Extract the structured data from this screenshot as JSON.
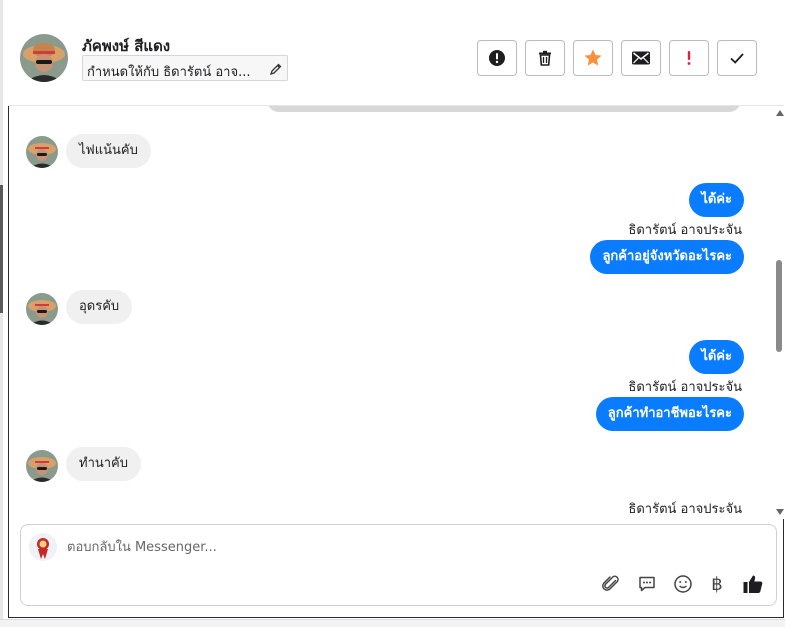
{
  "header": {
    "contact_name": "ภัคพงษ์ สีแดง",
    "assigned_to": "กำหนดให้กับ ธิดารัตน์ อาจ...",
    "actions": [
      {
        "icon": "alert-circle-icon",
        "name": "mark-spam-button"
      },
      {
        "icon": "trash-icon",
        "name": "delete-button"
      },
      {
        "icon": "star-icon",
        "name": "star-button"
      },
      {
        "icon": "envelope-icon",
        "name": "mark-unread-button"
      },
      {
        "icon": "exclamation-icon",
        "name": "follow-up-button"
      },
      {
        "icon": "check-icon",
        "name": "mark-done-button"
      }
    ]
  },
  "messages": [
    {
      "direction": "in",
      "text": "ไฟแน้นคับ"
    },
    {
      "direction": "out",
      "text": "ได้ค่ะ"
    },
    {
      "direction": "sender",
      "text": "ธิดารัตน์ อาจประจัน"
    },
    {
      "direction": "out",
      "text": "ลูกค้าอยู่จังหวัดอะไรคะ"
    },
    {
      "direction": "in",
      "text": "อุดรคับ"
    },
    {
      "direction": "out",
      "text": "ได้ค่ะ"
    },
    {
      "direction": "sender",
      "text": "ธิดารัตน์ อาจประจัน"
    },
    {
      "direction": "out",
      "text": "ลูกค้าทำอาชีพอะไรคะ"
    },
    {
      "direction": "in",
      "text": "ทำนาคับ"
    },
    {
      "direction": "sender",
      "text": "ธิดารัตน์ อาจประจัน"
    }
  ],
  "composer": {
    "placeholder": "ตอบกลับใน Messenger...",
    "tools": [
      "paperclip-icon",
      "chat-bubble-icon",
      "smiley-icon",
      "baht-icon",
      "thumbs-up-icon"
    ],
    "baht_symbol": "฿"
  },
  "colors": {
    "outgoing_bubble": "#0a7cff",
    "incoming_bubble": "#f0f0f0",
    "star": "#f7923a",
    "alert_red": "#e41e3f"
  }
}
